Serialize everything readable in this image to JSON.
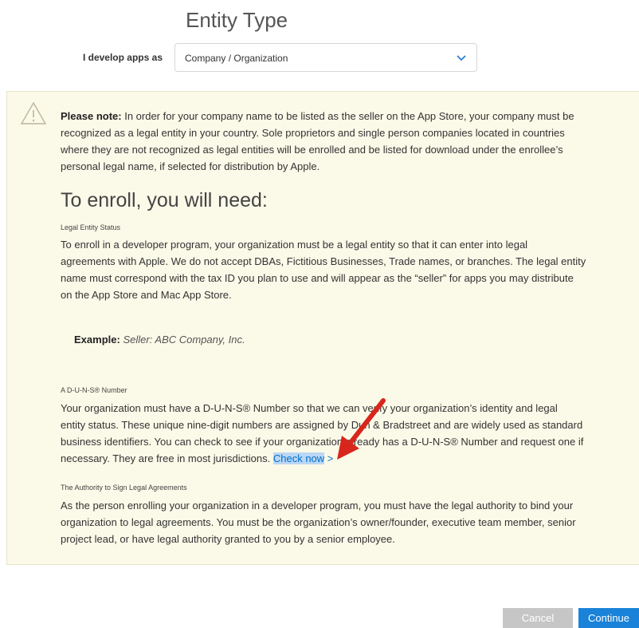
{
  "heading": "Entity Type",
  "develop": {
    "label": "I develop apps as",
    "value": "Company / Organization"
  },
  "note": {
    "bold": "Please note:",
    "lines": [
      " In order for your company name to be listed as the seller on the App Store, your company must be",
      "recognized as a legal entity in your country. Sole proprietors and single person companies located in countries",
      "where they are not recognized as legal entities will be enrolled and be listed for download under the enrollee’s",
      "personal legal name, if selected for distribution by Apple."
    ]
  },
  "enroll_heading": "To enroll, you will need:",
  "legal": {
    "title": "Legal Entity Status",
    "lines": [
      "To enroll in a developer program, your organization must be a legal entity so that it can enter into legal",
      "agreements with Apple. We do not accept DBAs, Fictitious Businesses, Trade names, or branches. The legal entity",
      "name must correspond with the tax ID you plan to use and will appear as the “seller” for apps you may distribute",
      "on the App Store and Mac App Store."
    ],
    "example_label": "Example:",
    "example_value": "Seller: ABC Company, Inc."
  },
  "duns": {
    "title": "A D-U-N-S® Number",
    "lines": [
      "Your organization must have a D-U-N-S® Number so that we can verify your organization’s identity and legal",
      "entity status. These unique nine-digit numbers are assigned by Dun & Bradstreet and are widely used as standard",
      "business identifiers. You can check to see if your organization already has a D-U-N-S® Number and request one if"
    ],
    "last_line": "necessary. They are free in most jurisdictions. ",
    "link": "Check now",
    "link_chevron": ">"
  },
  "authority": {
    "title": "The Authority to Sign Legal Agreements",
    "lines": [
      "As the person enrolling your organization in a developer program, you must have the legal authority to bind your",
      "organization to legal agreements. You must be the organization’s owner/founder, executive team member, senior",
      "project lead, or have legal authority granted to you by a senior employee."
    ]
  },
  "buttons": {
    "cancel": "Cancel",
    "continue": "Continue"
  },
  "colors": {
    "note_bg": "#fbf9e8",
    "link": "#0070c9",
    "continue_bg": "#1a82d8",
    "cancel_bg": "#c6c6c6",
    "arrow": "#d8261c"
  }
}
